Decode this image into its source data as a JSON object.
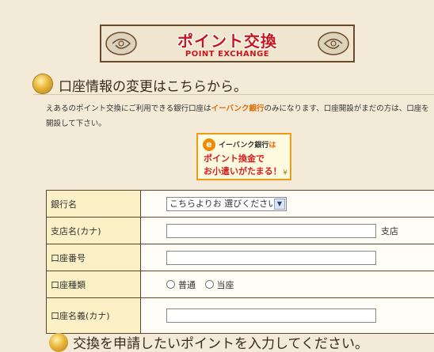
{
  "banner": {
    "title_jp": "ポイント交換",
    "title_en": "POINT EXCHANGE"
  },
  "section1": {
    "heading": "口座情報の変更はこちらから。",
    "desc_before": "えあるのポイント交換にご利用できる銀行口座は",
    "desc_highlight": "イーバンク銀行",
    "desc_after": "のみになります、口座開設がまだの方は、口座を開設して下さい。"
  },
  "ebank_banner": {
    "logo_letter": "e",
    "line1_a": "イーバンク銀行",
    "line1_b": "は",
    "line2": "ポイント換金で",
    "line3": "お小遣いがたまる！",
    "yen_mark": "¥"
  },
  "form": {
    "rows": [
      {
        "label": "銀行名",
        "select_value": "こちらよりお 選びください。"
      },
      {
        "label": "支店名(カナ)",
        "suffix": "支店"
      },
      {
        "label": "口座番号"
      },
      {
        "label": "口座種類",
        "options": [
          "普通",
          "当座"
        ]
      },
      {
        "label": "口座名義(カナ)"
      }
    ]
  },
  "section2": {
    "heading_partial": "交換を申請したいポイントを入力してください。"
  },
  "colors": {
    "background": "#f3ead7",
    "label_cell": "#fbf0c6",
    "accent_red": "#c8161d",
    "highlight_orange": "#e06a00"
  }
}
